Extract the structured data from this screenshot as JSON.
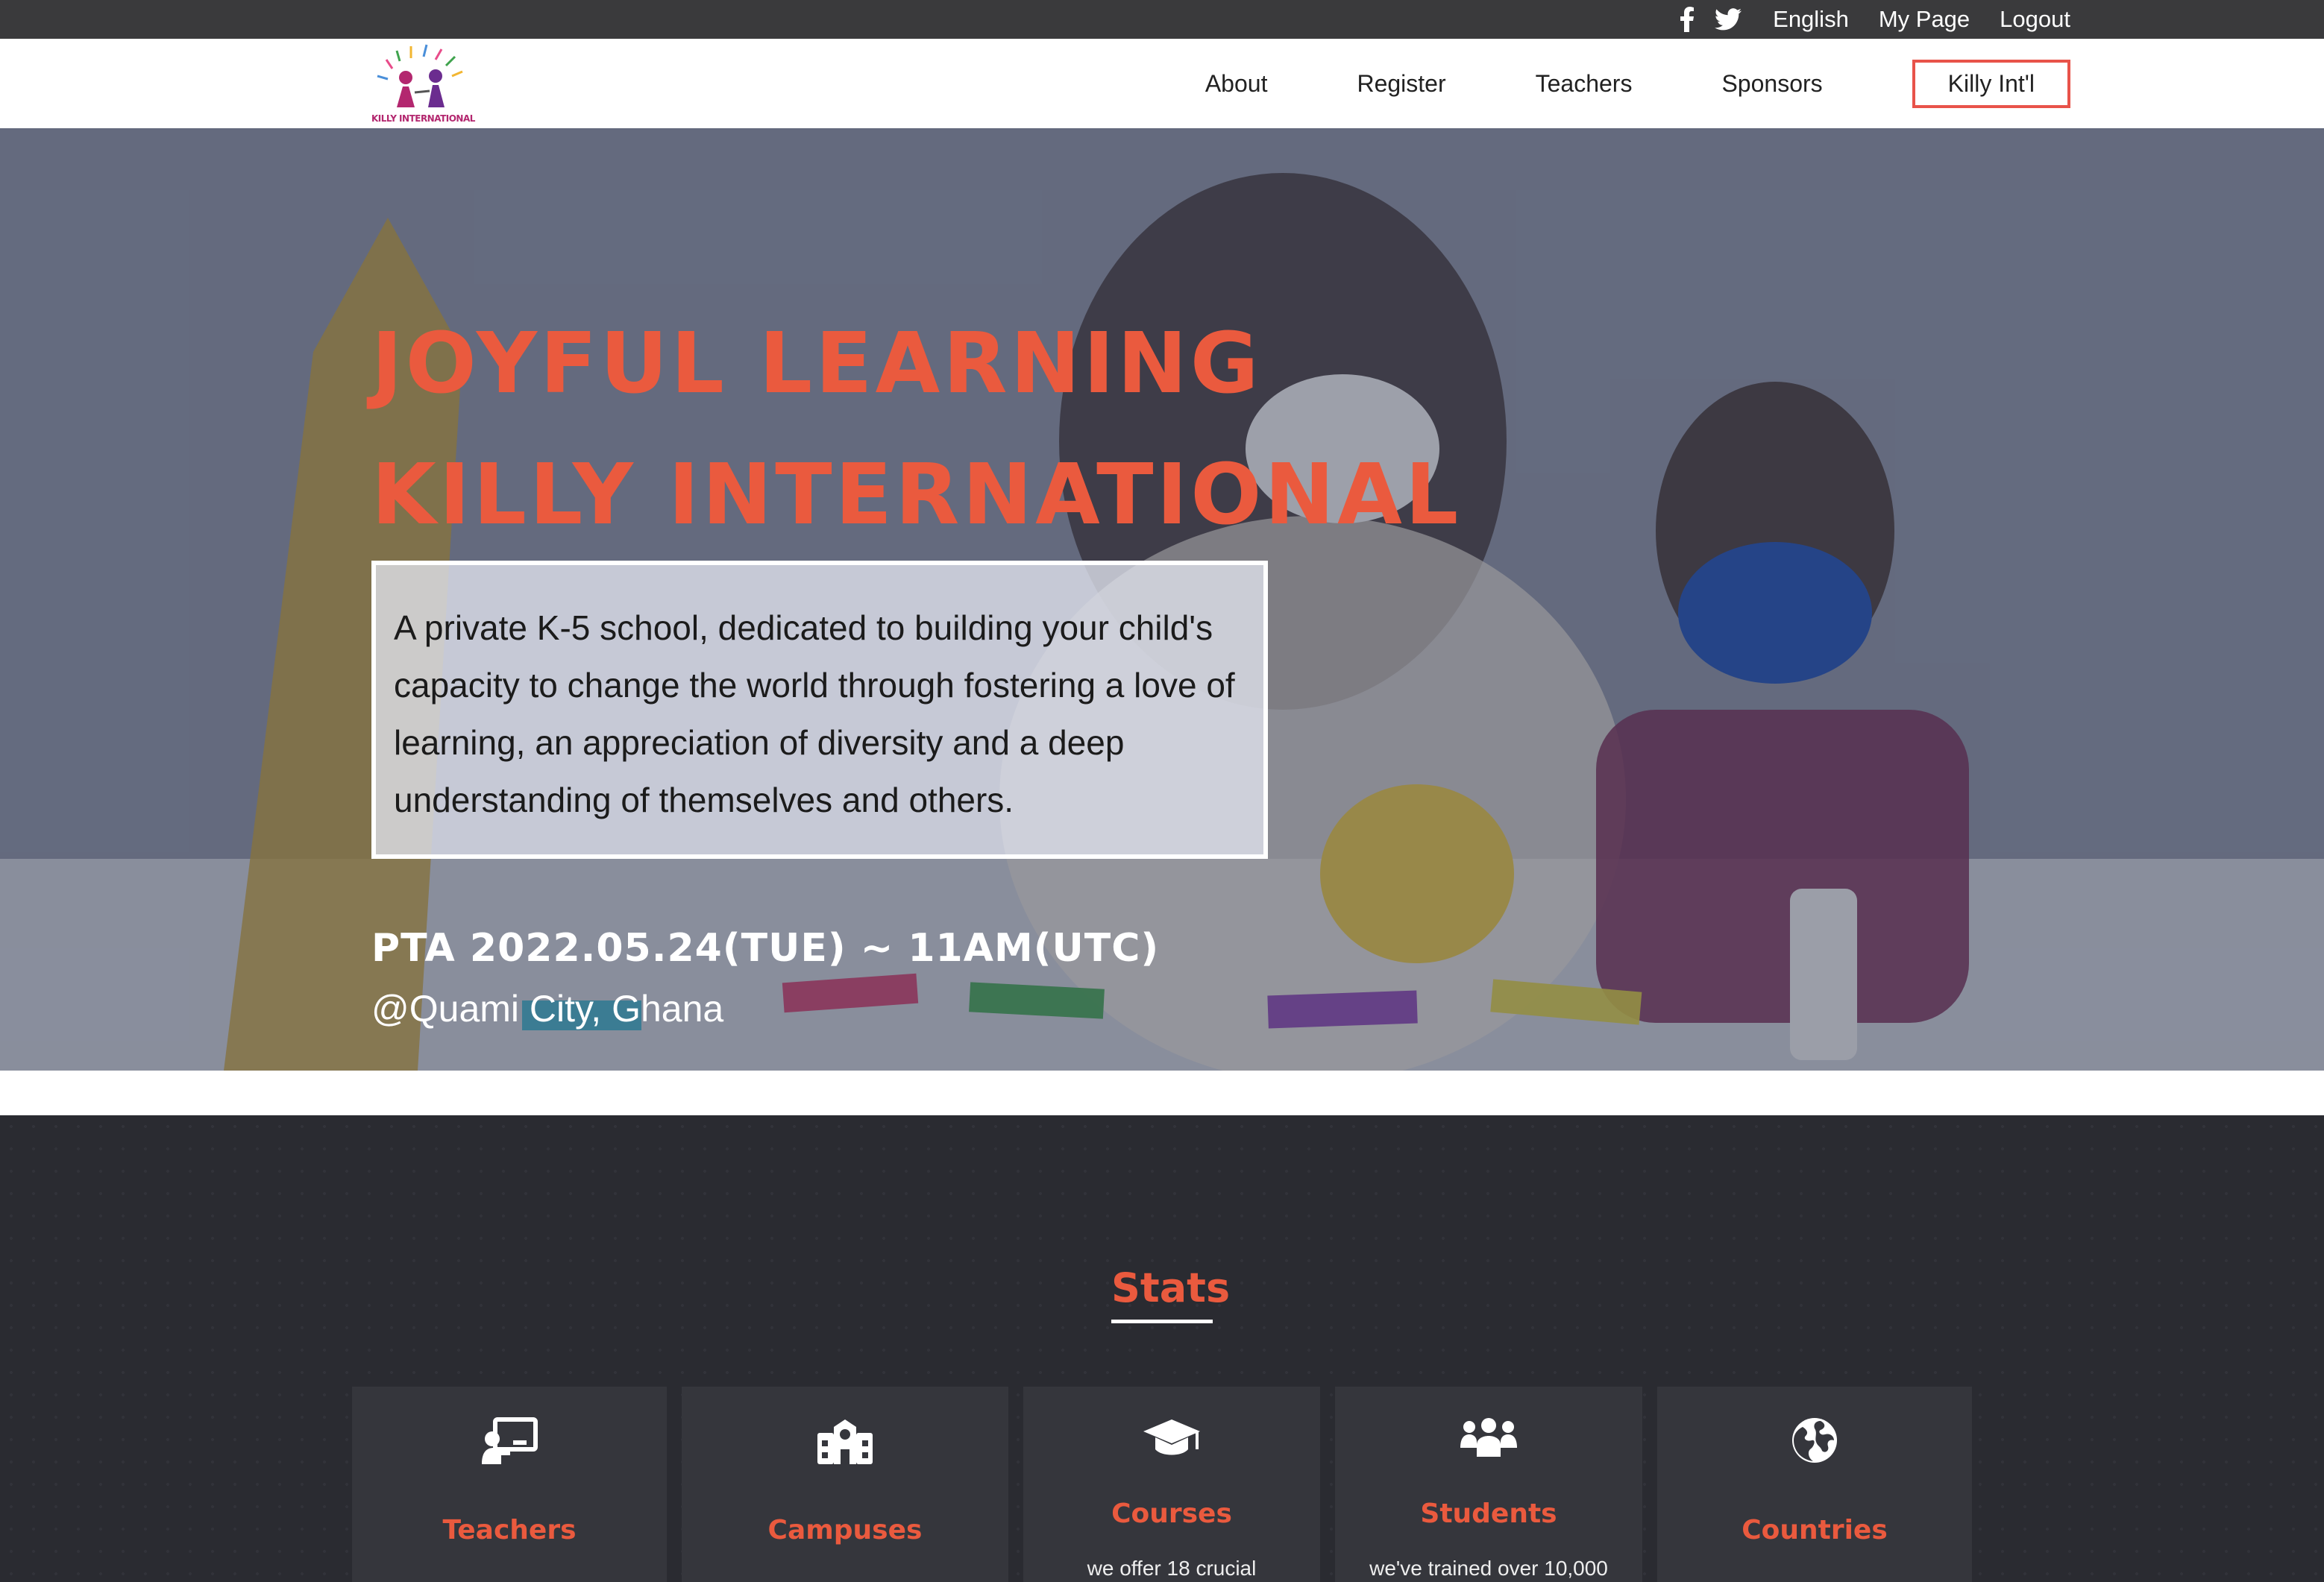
{
  "topbar": {
    "icons": [
      "facebook-icon",
      "twitter-icon"
    ],
    "language_label": "English",
    "mypage_label": "My Page",
    "logout_label": "Logout"
  },
  "nav": {
    "logo_text": "KILLY INTERNATIONAL",
    "links": [
      "About",
      "Register",
      "Teachers",
      "Sponsors"
    ],
    "cta_label": "Killy Int'l"
  },
  "hero": {
    "title_line1": "JOYFUL LEARNING",
    "title_line2": "KILLY INTERNATIONAL",
    "description": "A private K-5 school, dedicated to building your child's capacity to change the world through fostering a love of learning, an appreciation of diversity and a deep understanding of themselves and others.",
    "event": "PTA 2022.05.24(TUE) ~ 11AM(UTC)",
    "location": "@Quami City, Ghana"
  },
  "stats": {
    "title": "Stats",
    "cards": [
      {
        "icon": "teacher-board-icon",
        "label": "Teachers",
        "sub": ""
      },
      {
        "icon": "school-building-icon",
        "label": "Campuses",
        "sub": ""
      },
      {
        "icon": "graduation-cap-icon",
        "label": "Courses",
        "sub": "we offer 18 crucial"
      },
      {
        "icon": "people-group-icon",
        "label": "Students",
        "sub": "we've trained over 10,000"
      },
      {
        "icon": "globe-icon",
        "label": "Countries",
        "sub": ""
      }
    ]
  },
  "colors": {
    "accent": "#ea5a3e",
    "topbar": "#3a3a3c",
    "stats_bg": "#2a2b31",
    "card_bg": "#35363c"
  }
}
